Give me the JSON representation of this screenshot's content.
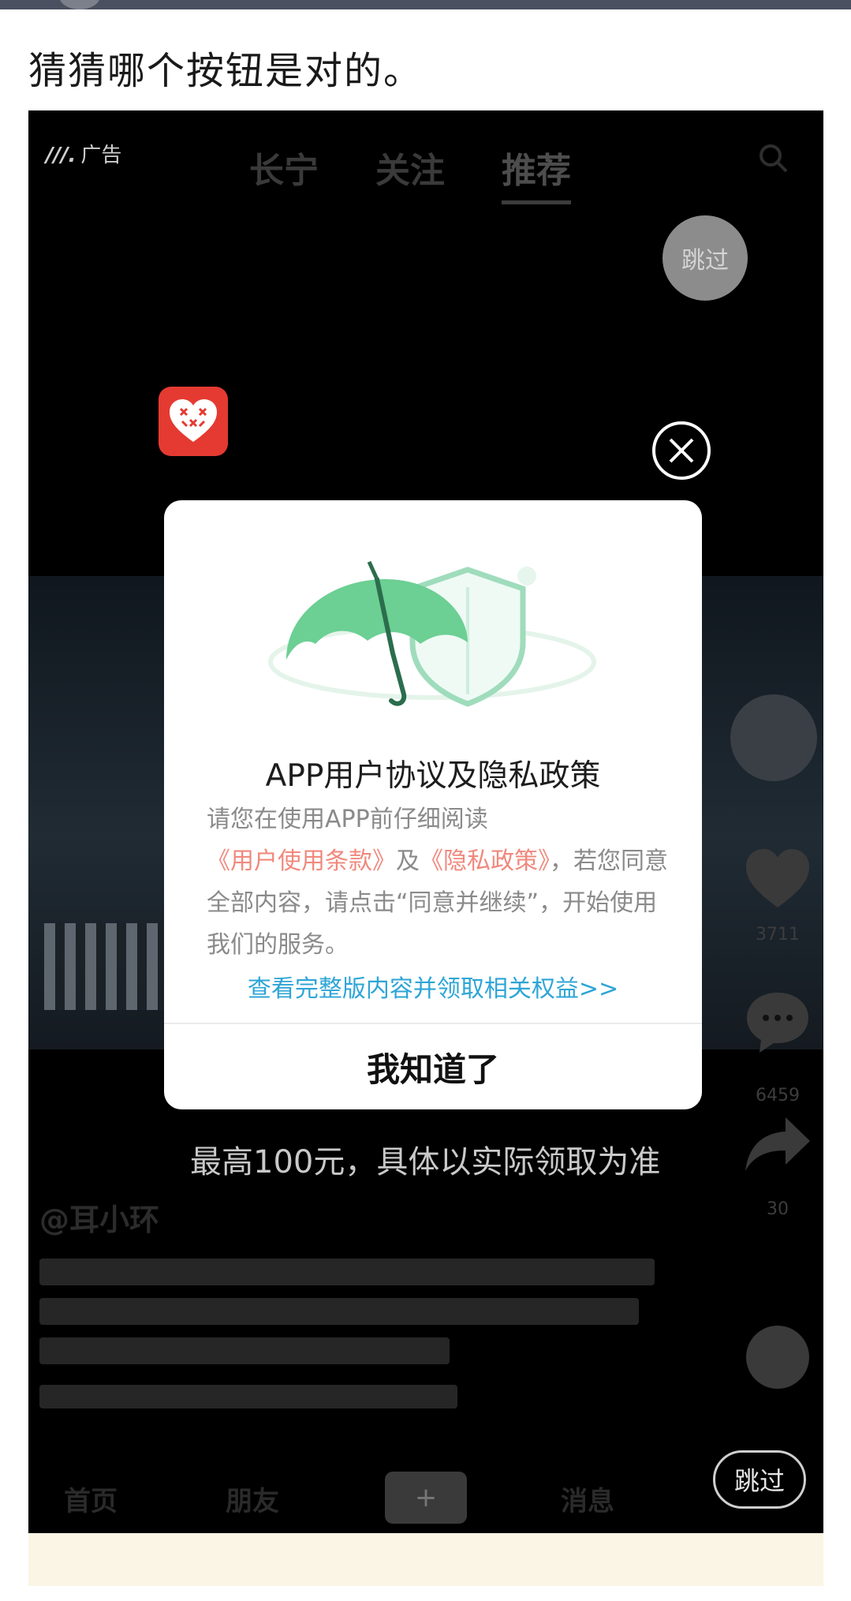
{
  "post": {
    "text": "猜猜哪个按钮是对的。"
  },
  "ad_screen": {
    "ad_label": "广告",
    "feed_tabs": [
      "长宁",
      "关注",
      "推荐"
    ],
    "skip_top_label": "跳过",
    "promo_text": "最高100元，具体以实际领取为准",
    "author": "@耳小环",
    "counts": {
      "likes": "3711",
      "comments": "6459",
      "shares": "30"
    },
    "bottom_nav": [
      "首页",
      "朋友",
      "消息"
    ],
    "plus_label": "+",
    "skip_bottom_label": "跳过"
  },
  "dialog": {
    "title": "APP用户协议及隐私政策",
    "body_prefix": "请您在使用APP前仔细阅读",
    "link_terms": "《用户使用条款》",
    "body_and": "及",
    "link_privacy": "《隐私政策》",
    "body_suffix": "，若您同意全部内容，请点击“同意并继续”，开始使用我们的服务。",
    "full_link": "查看完整版内容并领取相关权益>>",
    "ok_label": "我知道了"
  },
  "icons": {
    "search": "search-icon",
    "close": "close-circle-icon",
    "app": "pinduoduo-app-icon",
    "heart": "heart-icon",
    "comment": "comment-icon",
    "share": "share-icon",
    "umbrella": "umbrella-shield-illustration"
  },
  "colors": {
    "link_terms": "#f0897d",
    "full_link": "#2ea5d6",
    "app_icon": "#e43a32",
    "umbrella": "#6ccf93"
  }
}
